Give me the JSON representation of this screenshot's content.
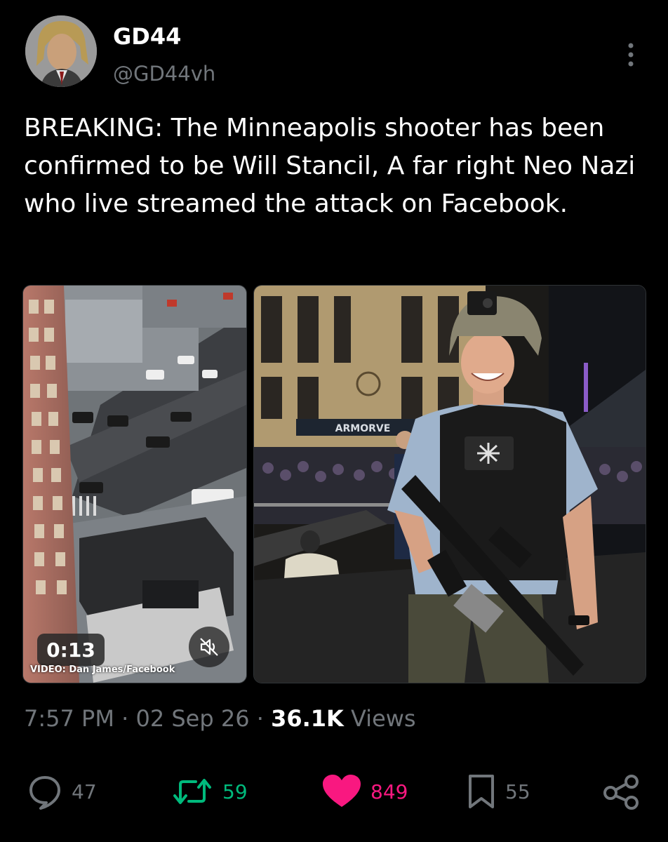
{
  "author": {
    "display_name": "GD44",
    "handle": "@GD44vh",
    "avatar_icon": "avatar-portrait"
  },
  "tweet": {
    "text": "BREAKING: The Minneapolis shooter has been confirmed to be Will Stancil, A far right Neo Nazi who live streamed the attack on Facebook."
  },
  "media": {
    "video": {
      "duration": "0:13",
      "credit": "VIDEO: Dan James/Facebook",
      "mute_icon": "speaker-muted-icon"
    },
    "photo": {
      "sign_text": "ARMORVE",
      "description_icon": "photo"
    }
  },
  "meta": {
    "time": "7:57 PM",
    "separator": " · ",
    "date": "02 Sep 26",
    "views_count": "36.1K",
    "views_label": " Views"
  },
  "actions": {
    "replies": "47",
    "retweets": "59",
    "likes": "849",
    "bookmarks": "55"
  },
  "colors": {
    "background": "#000000",
    "text": "#ffffff",
    "muted": "#71767b",
    "retweet": "#00ba7c",
    "like": "#f91880"
  }
}
